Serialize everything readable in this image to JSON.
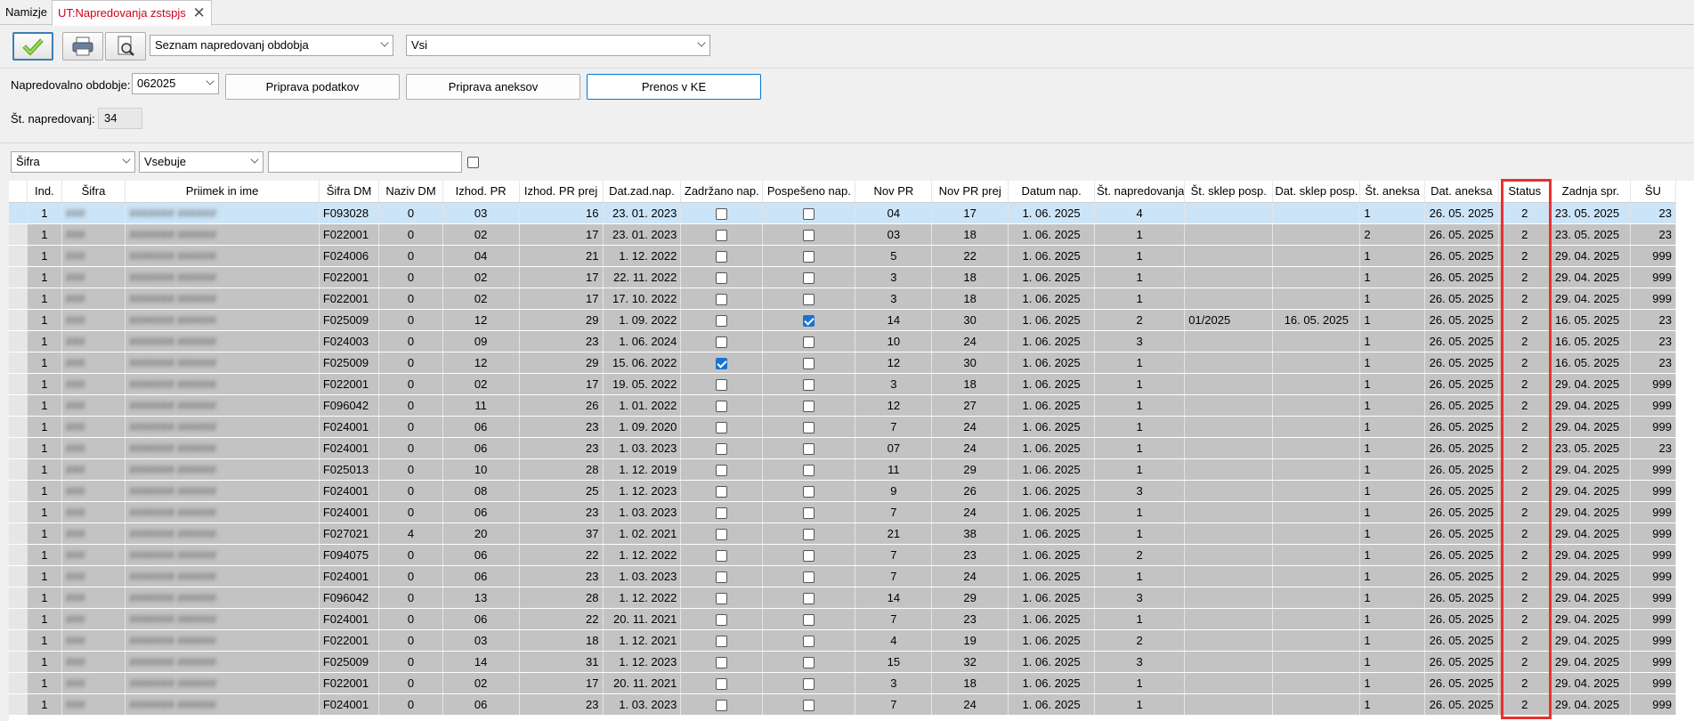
{
  "tabs": [
    {
      "label": "Namizje"
    },
    {
      "label": "UT:Napredovanja zstspjs",
      "close": "✕"
    }
  ],
  "toolbar": {
    "report_select": "Seznam napredovanj obdobja",
    "filter_select": "Vsi"
  },
  "period": {
    "label": "Napredovalno obdobje:",
    "value": "062025"
  },
  "buttons": {
    "prepare_data": "Priprava podatkov",
    "prepare_annex": "Priprava aneksov",
    "transfer": "Prenos v KE"
  },
  "count": {
    "label": "Št. napredovanj:",
    "value": "34"
  },
  "search": {
    "field": "Šifra",
    "operator": "Vsebuje",
    "value": ""
  },
  "table": {
    "columns": [
      "",
      "Ind.",
      "Šifra",
      "Priimek in ime",
      "Šifra DM",
      "Naziv DM",
      "Izhod. PR",
      "Izhod. PR prej",
      "Dat.zad.nap.",
      "Zadržano nap.",
      "Pospešeno nap.",
      "Nov PR",
      "Nov PR prej",
      "Datum nap.",
      "Št. napredovanja",
      "Št. sklep posp.",
      "Dat. sklep posp.",
      "Št. aneksa",
      "Dat. aneksa",
      "Status",
      "Zadnja spr.",
      "ŠU"
    ],
    "rows": [
      {
        "ind": "1",
        "sifra": "###",
        "name": "####### ######",
        "sdm": "F093028",
        "ndm": "0",
        "ipr": "03",
        "iprp": "16",
        "dzn": "23. 01. 2023",
        "zad": false,
        "posp": false,
        "npr": "04",
        "nprp": "17",
        "dn": "1. 06. 2025",
        "stn": "4",
        "ssp": "",
        "dsp": "",
        "sta": "1",
        "dan": "26. 05. 2025",
        "status": "2",
        "zs": "23. 05. 2025",
        "su": "23"
      },
      {
        "ind": "1",
        "sifra": "###",
        "name": "####### ######",
        "sdm": "F022001",
        "ndm": "0",
        "ipr": "02",
        "iprp": "17",
        "dzn": "23. 01. 2023",
        "zad": false,
        "posp": false,
        "npr": "03",
        "nprp": "18",
        "dn": "1. 06. 2025",
        "stn": "1",
        "ssp": "",
        "dsp": "",
        "sta": "2",
        "dan": "26. 05. 2025",
        "status": "2",
        "zs": "23. 05. 2025",
        "su": "23"
      },
      {
        "ind": "1",
        "sifra": "###",
        "name": "####### ######",
        "sdm": "F024006",
        "ndm": "0",
        "ipr": "04",
        "iprp": "21",
        "dzn": "1. 12. 2022",
        "zad": false,
        "posp": false,
        "npr": "5",
        "nprp": "22",
        "dn": "1. 06. 2025",
        "stn": "1",
        "ssp": "",
        "dsp": "",
        "sta": "1",
        "dan": "26. 05. 2025",
        "status": "2",
        "zs": "29. 04. 2025",
        "su": "999"
      },
      {
        "ind": "1",
        "sifra": "###",
        "name": "####### ######",
        "sdm": "F022001",
        "ndm": "0",
        "ipr": "02",
        "iprp": "17",
        "dzn": "22. 11. 2022",
        "zad": false,
        "posp": false,
        "npr": "3",
        "nprp": "18",
        "dn": "1. 06. 2025",
        "stn": "1",
        "ssp": "",
        "dsp": "",
        "sta": "1",
        "dan": "26. 05. 2025",
        "status": "2",
        "zs": "29. 04. 2025",
        "su": "999"
      },
      {
        "ind": "1",
        "sifra": "###",
        "name": "####### ######",
        "sdm": "F022001",
        "ndm": "0",
        "ipr": "02",
        "iprp": "17",
        "dzn": "17. 10. 2022",
        "zad": false,
        "posp": false,
        "npr": "3",
        "nprp": "18",
        "dn": "1. 06. 2025",
        "stn": "1",
        "ssp": "",
        "dsp": "",
        "sta": "1",
        "dan": "26. 05. 2025",
        "status": "2",
        "zs": "29. 04. 2025",
        "su": "999"
      },
      {
        "ind": "1",
        "sifra": "###",
        "name": "####### ######",
        "sdm": "F025009",
        "ndm": "0",
        "ipr": "12",
        "iprp": "29",
        "dzn": "1. 09. 2022",
        "zad": false,
        "posp": true,
        "npr": "14",
        "nprp": "30",
        "dn": "1. 06. 2025",
        "stn": "2",
        "ssp": "01/2025",
        "dsp": "16. 05. 2025",
        "sta": "1",
        "dan": "26. 05. 2025",
        "status": "2",
        "zs": "16. 05. 2025",
        "su": "23"
      },
      {
        "ind": "1",
        "sifra": "###",
        "name": "####### ######",
        "sdm": "F024003",
        "ndm": "0",
        "ipr": "09",
        "iprp": "23",
        "dzn": "1. 06. 2024",
        "zad": false,
        "posp": false,
        "npr": "10",
        "nprp": "24",
        "dn": "1. 06. 2025",
        "stn": "3",
        "ssp": "",
        "dsp": "",
        "sta": "1",
        "dan": "26. 05. 2025",
        "status": "2",
        "zs": "16. 05. 2025",
        "su": "23"
      },
      {
        "ind": "1",
        "sifra": "###",
        "name": "####### ######",
        "sdm": "F025009",
        "ndm": "0",
        "ipr": "12",
        "iprp": "29",
        "dzn": "15. 06. 2022",
        "zad": true,
        "posp": false,
        "npr": "12",
        "nprp": "30",
        "dn": "1. 06. 2025",
        "stn": "1",
        "ssp": "",
        "dsp": "",
        "sta": "1",
        "dan": "26. 05. 2025",
        "status": "2",
        "zs": "16. 05. 2025",
        "su": "23"
      },
      {
        "ind": "1",
        "sifra": "###",
        "name": "####### ######",
        "sdm": "F022001",
        "ndm": "0",
        "ipr": "02",
        "iprp": "17",
        "dzn": "19. 05. 2022",
        "zad": false,
        "posp": false,
        "npr": "3",
        "nprp": "18",
        "dn": "1. 06. 2025",
        "stn": "1",
        "ssp": "",
        "dsp": "",
        "sta": "1",
        "dan": "26. 05. 2025",
        "status": "2",
        "zs": "29. 04. 2025",
        "su": "999"
      },
      {
        "ind": "1",
        "sifra": "###",
        "name": "####### ######",
        "sdm": "F096042",
        "ndm": "0",
        "ipr": "11",
        "iprp": "26",
        "dzn": "1. 01. 2022",
        "zad": false,
        "posp": false,
        "npr": "12",
        "nprp": "27",
        "dn": "1. 06. 2025",
        "stn": "1",
        "ssp": "",
        "dsp": "",
        "sta": "1",
        "dan": "26. 05. 2025",
        "status": "2",
        "zs": "29. 04. 2025",
        "su": "999"
      },
      {
        "ind": "1",
        "sifra": "###",
        "name": "####### ######",
        "sdm": "F024001",
        "ndm": "0",
        "ipr": "06",
        "iprp": "23",
        "dzn": "1. 09. 2020",
        "zad": false,
        "posp": false,
        "npr": "7",
        "nprp": "24",
        "dn": "1. 06. 2025",
        "stn": "1",
        "ssp": "",
        "dsp": "",
        "sta": "1",
        "dan": "26. 05. 2025",
        "status": "2",
        "zs": "29. 04. 2025",
        "su": "999"
      },
      {
        "ind": "1",
        "sifra": "###",
        "name": "####### ######",
        "sdm": "F024001",
        "ndm": "0",
        "ipr": "06",
        "iprp": "23",
        "dzn": "1. 03. 2023",
        "zad": false,
        "posp": false,
        "npr": "07",
        "nprp": "24",
        "dn": "1. 06. 2025",
        "stn": "1",
        "ssp": "",
        "dsp": "",
        "sta": "1",
        "dan": "26. 05. 2025",
        "status": "2",
        "zs": "23. 05. 2025",
        "su": "23"
      },
      {
        "ind": "1",
        "sifra": "###",
        "name": "####### ######",
        "sdm": "F025013",
        "ndm": "0",
        "ipr": "10",
        "iprp": "28",
        "dzn": "1. 12. 2019",
        "zad": false,
        "posp": false,
        "npr": "11",
        "nprp": "29",
        "dn": "1. 06. 2025",
        "stn": "1",
        "ssp": "",
        "dsp": "",
        "sta": "1",
        "dan": "26. 05. 2025",
        "status": "2",
        "zs": "29. 04. 2025",
        "su": "999"
      },
      {
        "ind": "1",
        "sifra": "###",
        "name": "####### ######",
        "sdm": "F024001",
        "ndm": "0",
        "ipr": "08",
        "iprp": "25",
        "dzn": "1. 12. 2023",
        "zad": false,
        "posp": false,
        "npr": "9",
        "nprp": "26",
        "dn": "1. 06. 2025",
        "stn": "3",
        "ssp": "",
        "dsp": "",
        "sta": "1",
        "dan": "26. 05. 2025",
        "status": "2",
        "zs": "29. 04. 2025",
        "su": "999"
      },
      {
        "ind": "1",
        "sifra": "###",
        "name": "####### ######",
        "sdm": "F024001",
        "ndm": "0",
        "ipr": "06",
        "iprp": "23",
        "dzn": "1. 03. 2023",
        "zad": false,
        "posp": false,
        "npr": "7",
        "nprp": "24",
        "dn": "1. 06. 2025",
        "stn": "1",
        "ssp": "",
        "dsp": "",
        "sta": "1",
        "dan": "26. 05. 2025",
        "status": "2",
        "zs": "29. 04. 2025",
        "su": "999"
      },
      {
        "ind": "1",
        "sifra": "###",
        "name": "####### ######",
        "sdm": "F027021",
        "ndm": "4",
        "ipr": "20",
        "iprp": "37",
        "dzn": "1. 02. 2021",
        "zad": false,
        "posp": false,
        "npr": "21",
        "nprp": "38",
        "dn": "1. 06. 2025",
        "stn": "1",
        "ssp": "",
        "dsp": "",
        "sta": "1",
        "dan": "26. 05. 2025",
        "status": "2",
        "zs": "29. 04. 2025",
        "su": "999"
      },
      {
        "ind": "1",
        "sifra": "###",
        "name": "####### ######",
        "sdm": "F094075",
        "ndm": "0",
        "ipr": "06",
        "iprp": "22",
        "dzn": "1. 12. 2022",
        "zad": false,
        "posp": false,
        "npr": "7",
        "nprp": "23",
        "dn": "1. 06. 2025",
        "stn": "2",
        "ssp": "",
        "dsp": "",
        "sta": "1",
        "dan": "26. 05. 2025",
        "status": "2",
        "zs": "29. 04. 2025",
        "su": "999"
      },
      {
        "ind": "1",
        "sifra": "###",
        "name": "####### ######",
        "sdm": "F024001",
        "ndm": "0",
        "ipr": "06",
        "iprp": "23",
        "dzn": "1. 03. 2023",
        "zad": false,
        "posp": false,
        "npr": "7",
        "nprp": "24",
        "dn": "1. 06. 2025",
        "stn": "1",
        "ssp": "",
        "dsp": "",
        "sta": "1",
        "dan": "26. 05. 2025",
        "status": "2",
        "zs": "29. 04. 2025",
        "su": "999"
      },
      {
        "ind": "1",
        "sifra": "###",
        "name": "####### ######",
        "sdm": "F096042",
        "ndm": "0",
        "ipr": "13",
        "iprp": "28",
        "dzn": "1. 12. 2022",
        "zad": false,
        "posp": false,
        "npr": "14",
        "nprp": "29",
        "dn": "1. 06. 2025",
        "stn": "3",
        "ssp": "",
        "dsp": "",
        "sta": "1",
        "dan": "26. 05. 2025",
        "status": "2",
        "zs": "29. 04. 2025",
        "su": "999"
      },
      {
        "ind": "1",
        "sifra": "###",
        "name": "####### ######",
        "sdm": "F024001",
        "ndm": "0",
        "ipr": "06",
        "iprp": "22",
        "dzn": "20. 11. 2021",
        "zad": false,
        "posp": false,
        "npr": "7",
        "nprp": "23",
        "dn": "1. 06. 2025",
        "stn": "1",
        "ssp": "",
        "dsp": "",
        "sta": "1",
        "dan": "26. 05. 2025",
        "status": "2",
        "zs": "29. 04. 2025",
        "su": "999"
      },
      {
        "ind": "1",
        "sifra": "###",
        "name": "####### ######",
        "sdm": "F022001",
        "ndm": "0",
        "ipr": "03",
        "iprp": "18",
        "dzn": "1. 12. 2021",
        "zad": false,
        "posp": false,
        "npr": "4",
        "nprp": "19",
        "dn": "1. 06. 2025",
        "stn": "2",
        "ssp": "",
        "dsp": "",
        "sta": "1",
        "dan": "26. 05. 2025",
        "status": "2",
        "zs": "29. 04. 2025",
        "su": "999"
      },
      {
        "ind": "1",
        "sifra": "###",
        "name": "####### ######",
        "sdm": "F025009",
        "ndm": "0",
        "ipr": "14",
        "iprp": "31",
        "dzn": "1. 12. 2023",
        "zad": false,
        "posp": false,
        "npr": "15",
        "nprp": "32",
        "dn": "1. 06. 2025",
        "stn": "3",
        "ssp": "",
        "dsp": "",
        "sta": "1",
        "dan": "26. 05. 2025",
        "status": "2",
        "zs": "29. 04. 2025",
        "su": "999"
      },
      {
        "ind": "1",
        "sifra": "###",
        "name": "####### ######",
        "sdm": "F022001",
        "ndm": "0",
        "ipr": "02",
        "iprp": "17",
        "dzn": "20. 11. 2021",
        "zad": false,
        "posp": false,
        "npr": "3",
        "nprp": "18",
        "dn": "1. 06. 2025",
        "stn": "1",
        "ssp": "",
        "dsp": "",
        "sta": "1",
        "dan": "26. 05. 2025",
        "status": "2",
        "zs": "29. 04. 2025",
        "su": "999"
      },
      {
        "ind": "1",
        "sifra": "###",
        "name": "####### ######",
        "sdm": "F024001",
        "ndm": "0",
        "ipr": "06",
        "iprp": "23",
        "dzn": "1. 03. 2023",
        "zad": false,
        "posp": false,
        "npr": "7",
        "nprp": "24",
        "dn": "1. 06. 2025",
        "stn": "1",
        "ssp": "",
        "dsp": "",
        "sta": "1",
        "dan": "26. 05. 2025",
        "status": "2",
        "zs": "29. 04. 2025",
        "su": "999"
      }
    ]
  },
  "colors": {
    "highlight": "#e8312f",
    "selection": "#cce4f7",
    "row": "#c3c3c3",
    "check": "#1874d0"
  }
}
